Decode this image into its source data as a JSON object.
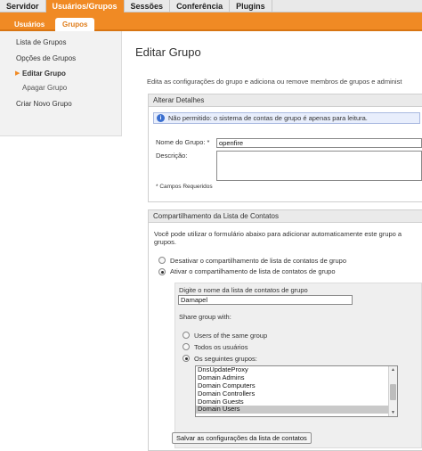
{
  "topnav": {
    "tabs": [
      {
        "label": "Servidor"
      },
      {
        "label": "Usuários/Grupos"
      },
      {
        "label": "Sessões"
      },
      {
        "label": "Conferência"
      },
      {
        "label": "Plugins"
      }
    ]
  },
  "subnav": {
    "tabs": [
      {
        "label": "Usuários"
      },
      {
        "label": "Grupos"
      }
    ]
  },
  "sidebar": {
    "items": [
      {
        "label": "Lista de Grupos"
      },
      {
        "label": "Opções de Grupos"
      },
      {
        "label": "Editar Grupo"
      },
      {
        "label": "Apagar Grupo"
      },
      {
        "label": "Criar Novo Grupo"
      }
    ]
  },
  "page": {
    "title": "Editar Grupo",
    "intro": "Edita as configurações do grupo e adiciona ou remove membros de grupos e administ"
  },
  "details": {
    "header": "Alterar Detalhes",
    "notice": "Não permitido: o sistema de contas de grupo é apenas para leitura.",
    "name_label": "Nome do Grupo: *",
    "name_value": "openfire",
    "desc_label": "Descrição:",
    "desc_value": "",
    "required_note": "* Campos Requeridos"
  },
  "sharing": {
    "header": "Compartilhamento da Lista de Contatos",
    "help_line1": "Você pode utilizar o formulário abaixo para adicionar automaticamente este grupo a",
    "help_line2": "grupos.",
    "disable_label": "Desativar o compartilhamento de lista de contatos de grupo",
    "enable_label": "Ativar o compartilhamento de lista de contatos de grupo",
    "list_name_label": "Digite o nome da lista de contatos de grupo",
    "list_name_value": "Damapel",
    "share_with_label": "Share group with:",
    "options": [
      {
        "label": "Users of the same group"
      },
      {
        "label": "Todos os usuários"
      },
      {
        "label": "Os seguintes grupos:"
      }
    ],
    "groups": [
      "DnsUpdateProxy",
      "Domain Admins",
      "Domain Computers",
      "Domain Controllers",
      "Domain Guests",
      "Domain Users"
    ],
    "selected_group": "Domain Users",
    "save_button": "Salvar as configurações da lista de contatos"
  },
  "colors": {
    "accent": "#f08a24",
    "notice_bg": "#e8eefc",
    "info_icon": "#3a6fd0"
  }
}
